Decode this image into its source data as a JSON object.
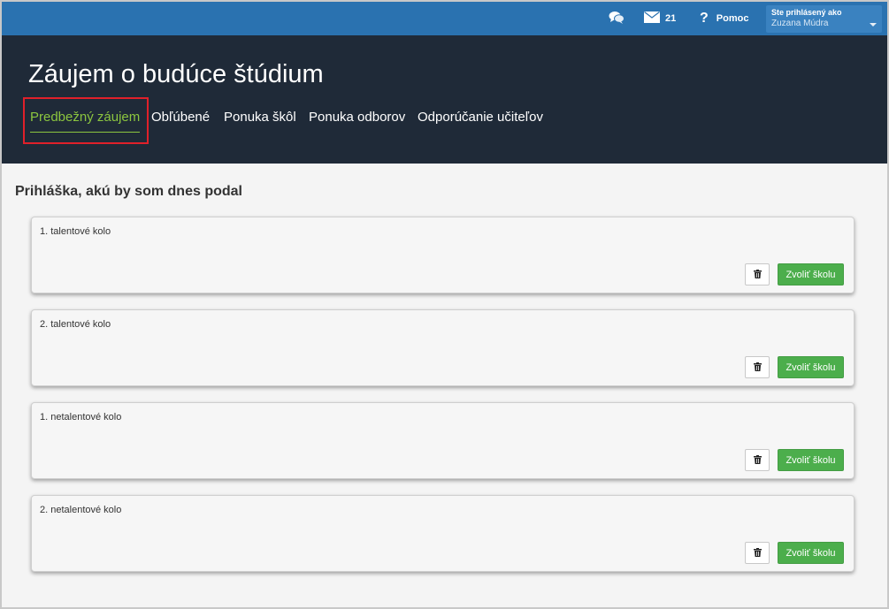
{
  "topbar": {
    "messages_count": "21",
    "help_label": "Pomoc",
    "user_caption": "Ste prihlásený ako",
    "user_name": "Zuzana Múdra"
  },
  "header": {
    "title": "Záujem o budúce štúdium",
    "tabs": [
      {
        "label": "Predbežný záujem",
        "active": true
      },
      {
        "label": "Obľúbené"
      },
      {
        "label": "Ponuka škôl"
      },
      {
        "label": "Ponuka odborov"
      },
      {
        "label": "Odporúčanie učiteľov"
      }
    ]
  },
  "content": {
    "section_title": "Prihláška, akú by som dnes podal",
    "cards": [
      {
        "label": "1. talentové kolo",
        "button": "Zvoliť školu"
      },
      {
        "label": "2. talentové kolo",
        "button": "Zvoliť školu"
      },
      {
        "label": "1. netalentové kolo",
        "button": "Zvoliť školu"
      },
      {
        "label": "2. netalentové kolo",
        "button": "Zvoliť školu"
      }
    ]
  },
  "colors": {
    "topbar": "#2a72b0",
    "header": "#1f2a38",
    "active_tab": "#8cc63f",
    "primary_button": "#4cae4c",
    "highlight": "#e0202a"
  }
}
